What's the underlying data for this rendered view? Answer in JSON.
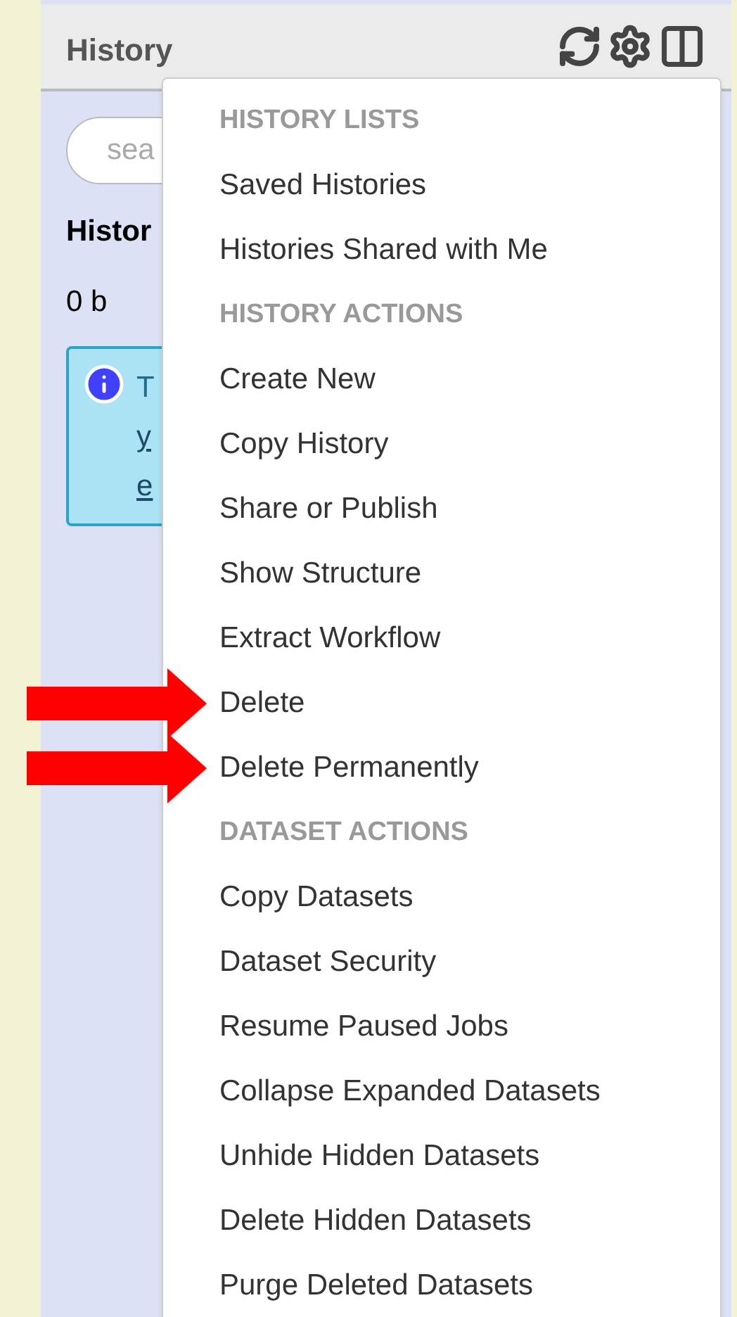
{
  "panel": {
    "title": "History",
    "search": {
      "placeholder": "sea"
    },
    "history_name": "Histor",
    "size": "0 b",
    "info_lines": [
      "T",
      "y",
      "e"
    ]
  },
  "menu": [
    {
      "kind": "header",
      "label": "HISTORY LISTS",
      "arrow": false
    },
    {
      "kind": "item",
      "label": "Saved Histories",
      "arrow": false
    },
    {
      "kind": "item",
      "label": "Histories Shared with Me",
      "arrow": false
    },
    {
      "kind": "header",
      "label": "HISTORY ACTIONS",
      "arrow": false
    },
    {
      "kind": "item",
      "label": "Create New",
      "arrow": false
    },
    {
      "kind": "item",
      "label": "Copy History",
      "arrow": false
    },
    {
      "kind": "item",
      "label": "Share or Publish",
      "arrow": false
    },
    {
      "kind": "item",
      "label": "Show Structure",
      "arrow": false
    },
    {
      "kind": "item",
      "label": "Extract Workflow",
      "arrow": false
    },
    {
      "kind": "item",
      "label": "Delete",
      "arrow": true
    },
    {
      "kind": "item",
      "label": "Delete Permanently",
      "arrow": true
    },
    {
      "kind": "header",
      "label": "DATASET ACTIONS",
      "arrow": false
    },
    {
      "kind": "item",
      "label": "Copy Datasets",
      "arrow": false
    },
    {
      "kind": "item",
      "label": "Dataset Security",
      "arrow": false
    },
    {
      "kind": "item",
      "label": "Resume Paused Jobs",
      "arrow": false
    },
    {
      "kind": "item",
      "label": "Collapse Expanded Datasets",
      "arrow": false
    },
    {
      "kind": "item",
      "label": "Unhide Hidden Datasets",
      "arrow": false
    },
    {
      "kind": "item",
      "label": "Delete Hidden Datasets",
      "arrow": false
    },
    {
      "kind": "item",
      "label": "Purge Deleted Datasets",
      "arrow": false
    }
  ]
}
